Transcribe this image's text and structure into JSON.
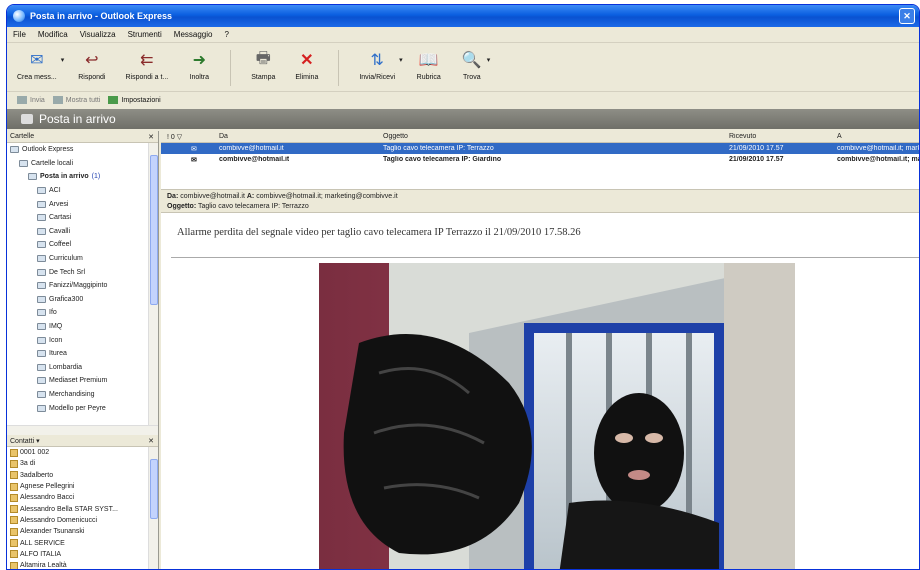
{
  "window": {
    "title": "Posta in arrivo - Outlook Express",
    "close_glyph": "✕"
  },
  "menu": [
    "File",
    "Modifica",
    "Visualizza",
    "Strumenti",
    "Messaggio",
    "?"
  ],
  "toolbar": [
    {
      "label": "Crea mess...",
      "icon": "new-message-icon",
      "glyph": "✉"
    },
    {
      "label": "Rispondi",
      "icon": "reply-icon",
      "glyph": "↩"
    },
    {
      "label": "Rispondi a t...",
      "icon": "reply-all-icon",
      "glyph": "⇇"
    },
    {
      "label": "Inoltra",
      "icon": "forward-icon",
      "glyph": "➜"
    },
    {
      "label": "Stampa",
      "icon": "print-icon",
      "glyph": "🖶"
    },
    {
      "label": "Elimina",
      "icon": "delete-icon",
      "glyph": "✕"
    },
    {
      "label": "Invia/Ricevi",
      "icon": "send-receive-icon",
      "glyph": "⇅"
    },
    {
      "label": "Rubrica",
      "icon": "address-book-icon",
      "glyph": "📖"
    },
    {
      "label": "Trova",
      "icon": "find-icon",
      "glyph": "🔍"
    }
  ],
  "subtoolbar": {
    "item1": "Invia",
    "item2": "Mostra tutti",
    "item3": "Impostazioni"
  },
  "folder_title": "Posta in arrivo",
  "folders_pane": {
    "header": "Cartelle",
    "items": [
      {
        "label": "Outlook Express",
        "indent": 0
      },
      {
        "label": "Cartelle locali",
        "indent": 1
      },
      {
        "label": "Posta in arrivo",
        "indent": 2,
        "count": "(1)",
        "bold": true
      },
      {
        "label": "ACI",
        "indent": 3
      },
      {
        "label": "Arvesi",
        "indent": 3
      },
      {
        "label": "Cartasi",
        "indent": 3
      },
      {
        "label": "Cavalli",
        "indent": 3
      },
      {
        "label": "Coffeel",
        "indent": 3
      },
      {
        "label": "Curriculum",
        "indent": 3
      },
      {
        "label": "De Tech Srl",
        "indent": 3
      },
      {
        "label": "Fanizzi/Maggipinto",
        "indent": 3
      },
      {
        "label": "Grafica300",
        "indent": 3
      },
      {
        "label": "Ifo",
        "indent": 3
      },
      {
        "label": "IMQ",
        "indent": 3
      },
      {
        "label": "Icon",
        "indent": 3
      },
      {
        "label": "Iturea",
        "indent": 3
      },
      {
        "label": "Lombardia",
        "indent": 3
      },
      {
        "label": "Mediaset Premium",
        "indent": 3
      },
      {
        "label": "Merchandising",
        "indent": 3
      },
      {
        "label": "Modello per Peyre",
        "indent": 3
      }
    ]
  },
  "contacts_pane": {
    "header": "Contatti ▾",
    "items": [
      "0001 002",
      "3a di",
      "3adalberto",
      "Agnese Pellegrini",
      "Alessandro Bacci",
      "Alessandro Bella STAR SYST...",
      "Alessandro Domenicucci",
      "Alexander Tsunanski",
      "ALL SERVICE",
      "ALFO ITALIA",
      "Altamira Lealtà"
    ]
  },
  "message_list": {
    "headers": {
      "flags": "! 0 ▽",
      "from": "Da",
      "subject": "Oggetto",
      "received": "Ricevuto",
      "to": "A"
    },
    "rows": [
      {
        "from": "combivve@hotmail.it",
        "subject": "Taglio cavo telecamera IP: Terrazzo",
        "received": "21/09/2010 17.57",
        "to": "combivve@hotmail.it; marketi",
        "selected": true,
        "bold": false
      },
      {
        "from": "combivve@hotmail.it",
        "subject": "Taglio cavo telecamera IP: Giardino",
        "received": "21/09/2010 17.57",
        "to": "combivve@hotmail.it; marketi",
        "selected": false,
        "bold": true
      }
    ]
  },
  "preview": {
    "from_label": "Da:",
    "from": "combivve@hotmail.it",
    "to_label": "A:",
    "to": "combivve@hotmail.it; marketing@combivve.it",
    "subject_label": "Oggetto:",
    "subject": "Taglio cavo telecamera IP: Terrazzo",
    "body": "Allarme perdita del segnale video per taglio cavo telecamera IP Terrazzo il 21/09/2010 17.58.26"
  },
  "colors": {
    "title_blue": "#0b5fe0",
    "selection": "#316ac5",
    "chrome": "#ece9d8"
  }
}
